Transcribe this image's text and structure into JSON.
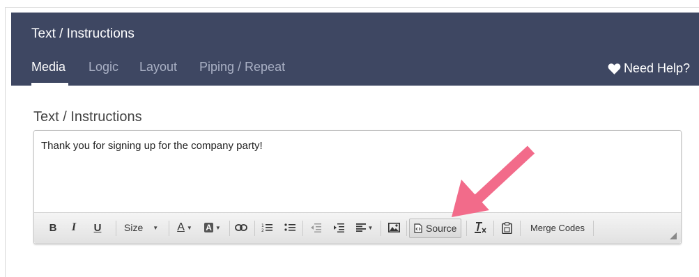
{
  "header": {
    "title": "Text / Instructions",
    "tabs": [
      {
        "label": "Media",
        "active": true
      },
      {
        "label": "Logic",
        "active": false
      },
      {
        "label": "Layout",
        "active": false
      },
      {
        "label": "Piping / Repeat",
        "active": false
      }
    ],
    "help_label": "Need Help?"
  },
  "section": {
    "label": "Text / Instructions"
  },
  "editor": {
    "content": "Thank you for signing up for the company party!",
    "toolbar": {
      "bold": "B",
      "italic": "I",
      "underline": "U",
      "size_label": "Size",
      "text_color": "A",
      "bg_color": "A",
      "source_label": "Source",
      "merge_codes_label": "Merge Codes"
    }
  },
  "colors": {
    "header_bg": "#3e4762",
    "tab_inactive": "#a9b0c4",
    "annotation_arrow": "#f26b8a"
  }
}
